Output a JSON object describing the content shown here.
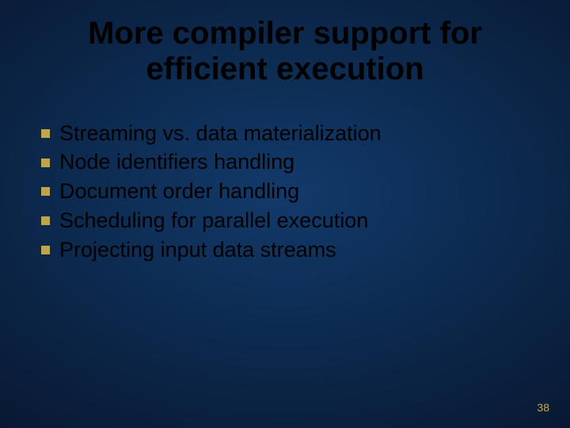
{
  "title_line1": "More compiler support for",
  "title_line2": "efficient execution",
  "bullets": {
    "b0": "Streaming vs. data materialization",
    "b1": "Node identifiers handling",
    "b2": "Document order handling",
    "b3": "Scheduling for parallel execution",
    "b4": "Projecting input data streams"
  },
  "page_number": "38"
}
